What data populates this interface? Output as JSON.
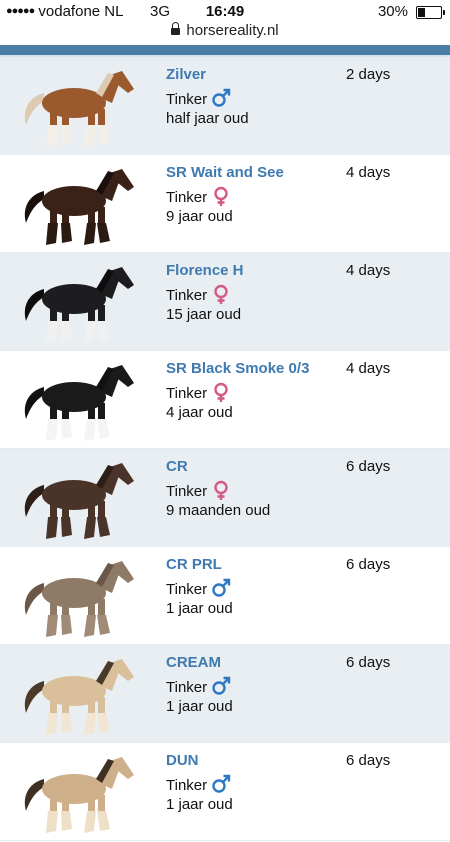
{
  "status_bar": {
    "carrier": "vodafone NL",
    "network": "3G",
    "time": "16:49",
    "battery_pct": "30%",
    "battery_level": 0.3
  },
  "browser": {
    "url": "horsereality.nl"
  },
  "colors": {
    "accent": "#3f7ab0",
    "band": "#4a7da3",
    "male": "#2f78c4",
    "female": "#d45a86",
    "row_shade": "#e9eef2"
  },
  "horses": [
    {
      "name": "Zilver",
      "breed": "Tinker",
      "gender": "male",
      "age": "half jaar oud",
      "time": "2 days",
      "coat": "#9a5a2e",
      "mane": "#dccbb0",
      "leg": "#f3eee6"
    },
    {
      "name": "SR Wait and See",
      "breed": "Tinker",
      "gender": "female",
      "age": "9 jaar oud",
      "time": "4 days",
      "coat": "#3a2218",
      "mane": "#1a0f0a",
      "leg": "#2a1a12"
    },
    {
      "name": "Florence H",
      "breed": "Tinker",
      "gender": "female",
      "age": "15 jaar oud",
      "time": "4 days",
      "coat": "#1d1d1f",
      "mane": "#0d0d0e",
      "leg": "#f0f0f0"
    },
    {
      "name": "SR Black Smoke 0/3",
      "breed": "Tinker",
      "gender": "female",
      "age": "4 jaar oud",
      "time": "4 days",
      "coat": "#1a1a1a",
      "mane": "#111111",
      "leg": "#f4f4f4"
    },
    {
      "name": "CR",
      "breed": "Tinker",
      "gender": "female",
      "age": "9 maanden oud",
      "time": "6 days",
      "coat": "#4a3429",
      "mane": "#2d1e17",
      "leg": "#4a3429"
    },
    {
      "name": "CR PRL",
      "breed": "Tinker",
      "gender": "male",
      "age": "1 jaar oud",
      "time": "6 days",
      "coat": "#8f7a67",
      "mane": "#6a5747",
      "leg": "#a08b77"
    },
    {
      "name": "CREAM",
      "breed": "Tinker",
      "gender": "male",
      "age": "1 jaar oud",
      "time": "6 days",
      "coat": "#d9c09a",
      "mane": "#4a3a2a",
      "leg": "#f1e6d4"
    },
    {
      "name": "DUN",
      "breed": "Tinker",
      "gender": "male",
      "age": "1 jaar oud",
      "time": "6 days",
      "coat": "#cdb08a",
      "mane": "#3f3024",
      "leg": "#eee0c8"
    }
  ]
}
